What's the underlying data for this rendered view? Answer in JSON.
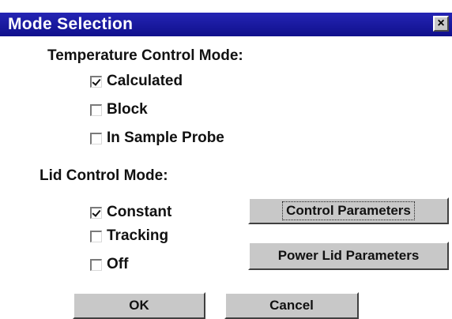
{
  "window": {
    "title": "Mode Selection",
    "close_glyph": "×"
  },
  "temperature": {
    "heading": "Temperature Control Mode:",
    "options": [
      {
        "label": "Calculated",
        "checked": true
      },
      {
        "label": "Block",
        "checked": false
      },
      {
        "label": "In Sample Probe",
        "checked": false
      }
    ]
  },
  "lid": {
    "heading": "Lid Control Mode:",
    "options": [
      {
        "label": "Constant",
        "checked": true
      },
      {
        "label": "Tracking",
        "checked": false
      },
      {
        "label": "Off",
        "checked": false
      }
    ]
  },
  "buttons": {
    "control_parameters": "Control Parameters",
    "power_lid_parameters": "Power Lid Parameters",
    "ok": "OK",
    "cancel": "Cancel"
  }
}
